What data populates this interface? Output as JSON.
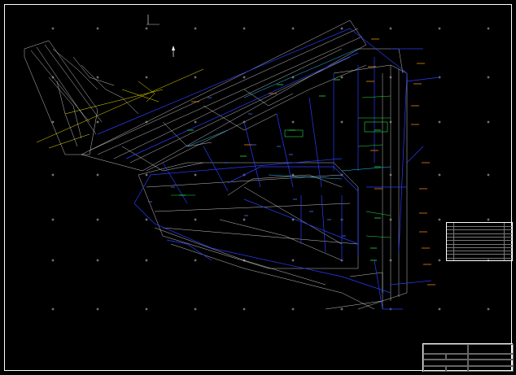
{
  "header": {
    "lines": [
      "",
      ""
    ]
  },
  "legend": {
    "rows": [
      {
        "num": "",
        "text": "",
        "val": ""
      },
      {
        "num": "",
        "text": "",
        "val": ""
      },
      {
        "num": "",
        "text": "",
        "val": ""
      },
      {
        "num": "",
        "text": "",
        "val": ""
      },
      {
        "num": "",
        "text": "",
        "val": ""
      },
      {
        "num": "",
        "text": "",
        "val": ""
      },
      {
        "num": "",
        "text": "",
        "val": ""
      },
      {
        "num": "",
        "text": "",
        "val": ""
      },
      {
        "num": "",
        "text": "",
        "val": ""
      },
      {
        "num": "",
        "text": "",
        "val": ""
      }
    ]
  },
  "title_block": {
    "cells": [
      "",
      "",
      "",
      "",
      "",
      "",
      "",
      "",
      "",
      ""
    ]
  },
  "sheet_label": "",
  "colors": {
    "background": "#000000",
    "frame": "#ffffff",
    "linework": "#d8d8d8",
    "parcel_lines": "#2a3cff",
    "green_labels": "#22dd44",
    "orange_labels": "#e08a10",
    "yellow_lines": "#e8e000",
    "cyan_lines": "#22c8ff"
  }
}
